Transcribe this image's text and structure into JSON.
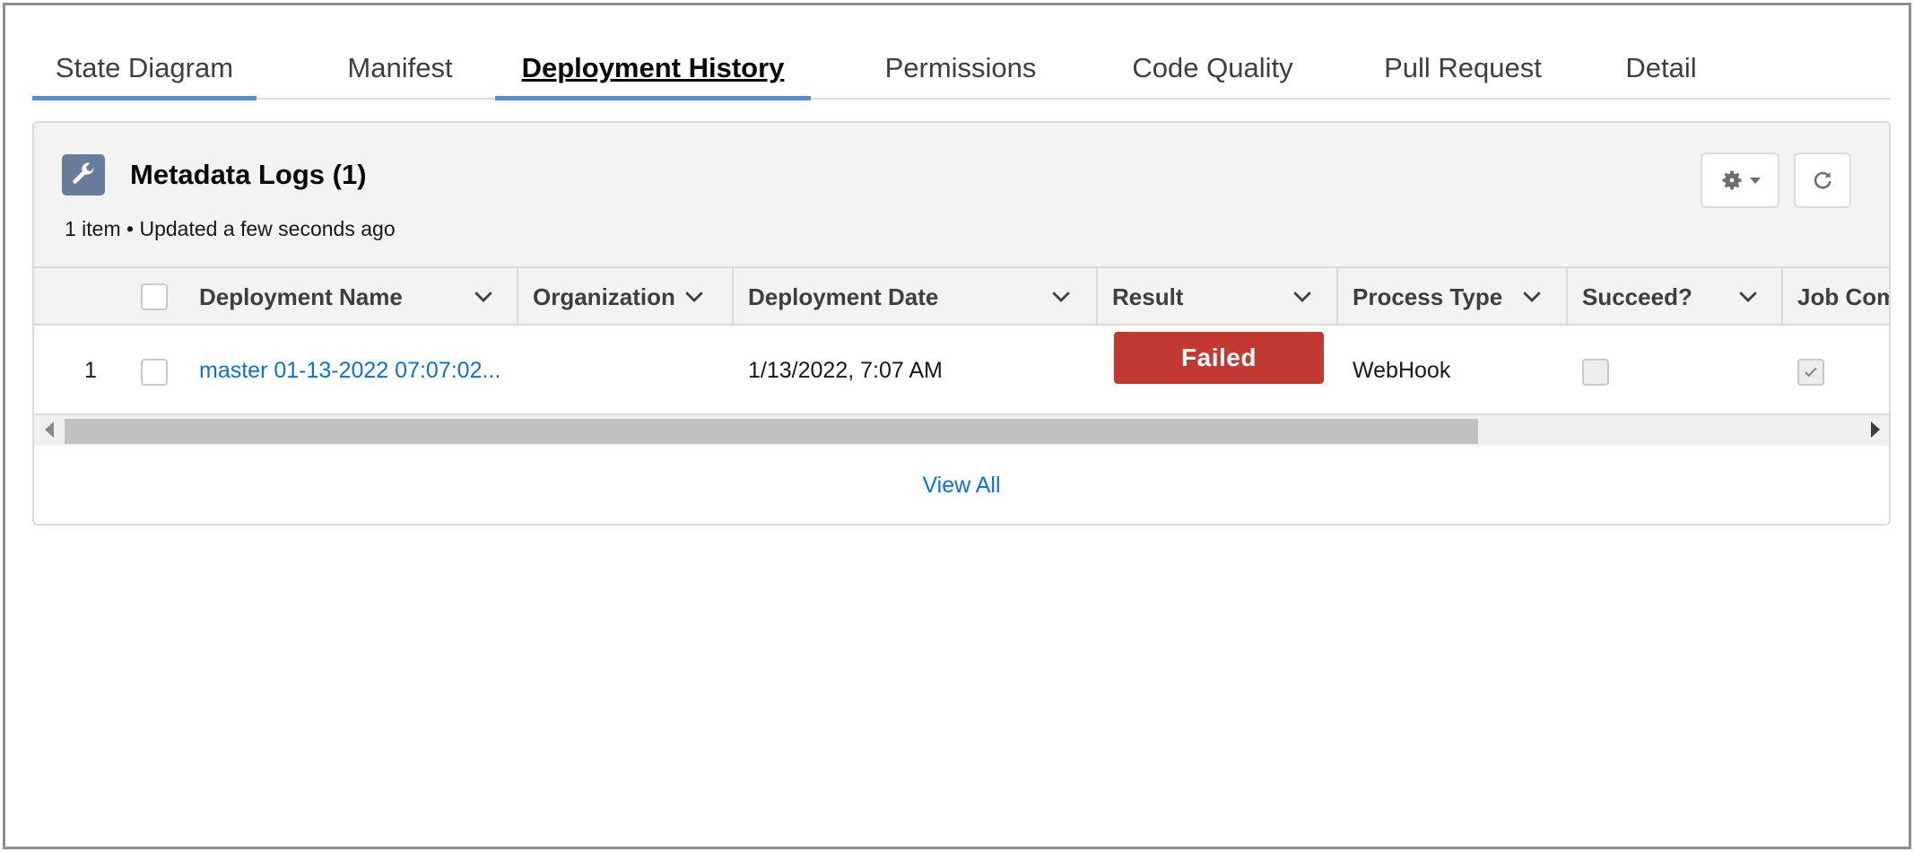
{
  "tabs": [
    {
      "label": "State Diagram"
    },
    {
      "label": "Manifest"
    },
    {
      "label": "Deployment History",
      "active": true
    },
    {
      "label": "Permissions"
    },
    {
      "label": "Code Quality"
    },
    {
      "label": "Pull Request"
    },
    {
      "label": "Detail"
    }
  ],
  "card": {
    "icon": "wrench-icon",
    "title": "Metadata Logs (1)",
    "subtitle": "1 item • Updated a few seconds ago",
    "settings_icon": "gear-icon",
    "refresh_icon": "refresh-icon"
  },
  "table": {
    "columns": [
      {
        "label": "Deployment Name"
      },
      {
        "label": "Organization"
      },
      {
        "label": "Deployment Date"
      },
      {
        "label": "Result"
      },
      {
        "label": "Process Type"
      },
      {
        "label": "Succeed?"
      },
      {
        "label": "Job Com"
      }
    ],
    "rows": [
      {
        "number": "1",
        "deployment_name": "master 01-13-2022 07:07:02...",
        "organization": "",
        "deployment_date": "1/13/2022, 7:07 AM",
        "result": "Failed",
        "process_type": "WebHook",
        "succeed": false,
        "job_completed": true
      }
    ]
  },
  "footer": {
    "view_all": "View All"
  },
  "colors": {
    "accent": "#4a90e2",
    "link": "#0b72d1",
    "failed": "#c23934",
    "icon_bg": "#6b7b9c"
  }
}
